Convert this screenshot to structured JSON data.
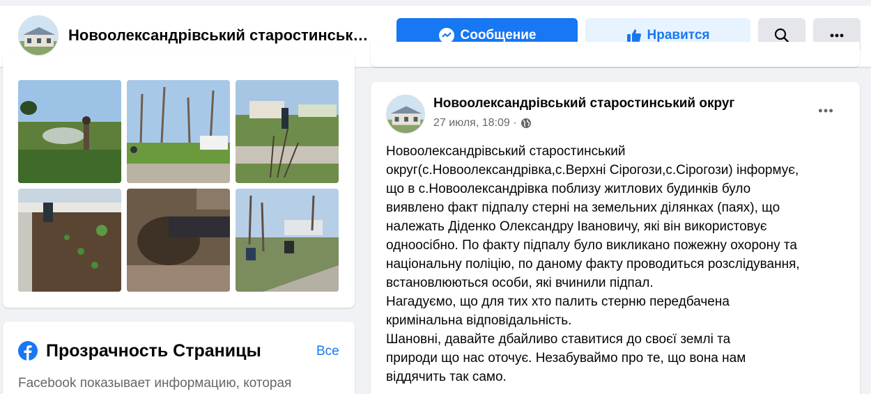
{
  "header": {
    "page_name": "Новоолександрівський старостинськ…",
    "message_label": "Сообщение",
    "like_label": "Нравится"
  },
  "icons": {
    "messenger": "messenger-icon",
    "like": "thumbs-up-icon",
    "search": "search-icon",
    "more": "more-horizontal-icon",
    "globe": "globe-icon",
    "facebook": "facebook-logo-icon"
  },
  "colors": {
    "accent": "#1877f2",
    "accent_light": "#e7f3ff",
    "grey_button": "#e4e6eb",
    "background": "#f0f2f5"
  },
  "photos": [
    {
      "name": "photo-field-burn"
    },
    {
      "name": "photo-orchard"
    },
    {
      "name": "photo-yard-bush"
    },
    {
      "name": "photo-garden-beds"
    },
    {
      "name": "photo-digging"
    },
    {
      "name": "photo-square-trees"
    }
  ],
  "transparency": {
    "title": "Прозрачность Страницы",
    "see_all": "Все",
    "text": "Facebook показывает информацию, которая"
  },
  "post": {
    "author": "Новоолександрівський старостинський округ",
    "date": "27 июля, 18:09 ·",
    "text": "Новоолександрівський старостинський\nокруг(с.Новоолександрівка,с.Верхні Сірогози,с.Сірогози) інформує,\nщо в с.Новоолександрівка поблизу житлових будинків було\nвиявлено факт підпалу стерні на земельних ділянках (паях), що\nналежать Діденко Олександру Івановичу, які він використовує\nодноосібно. По факту підпалу було викликано пожежну охорону та\nнаціональну поліцію, по даному факту проводиться розслідування,\nвстановлюються особи, які вчинили підпал.\n       Нагадуємо, що для тих хто палить стерню передбачена\nкримінальна відповідальність.\n       Шановні, давайте дбайливо ставитися до своєї землі та\nприроди що нас оточує. Незабуваймо про те,  що вона нам\nвіддячить так само."
  }
}
